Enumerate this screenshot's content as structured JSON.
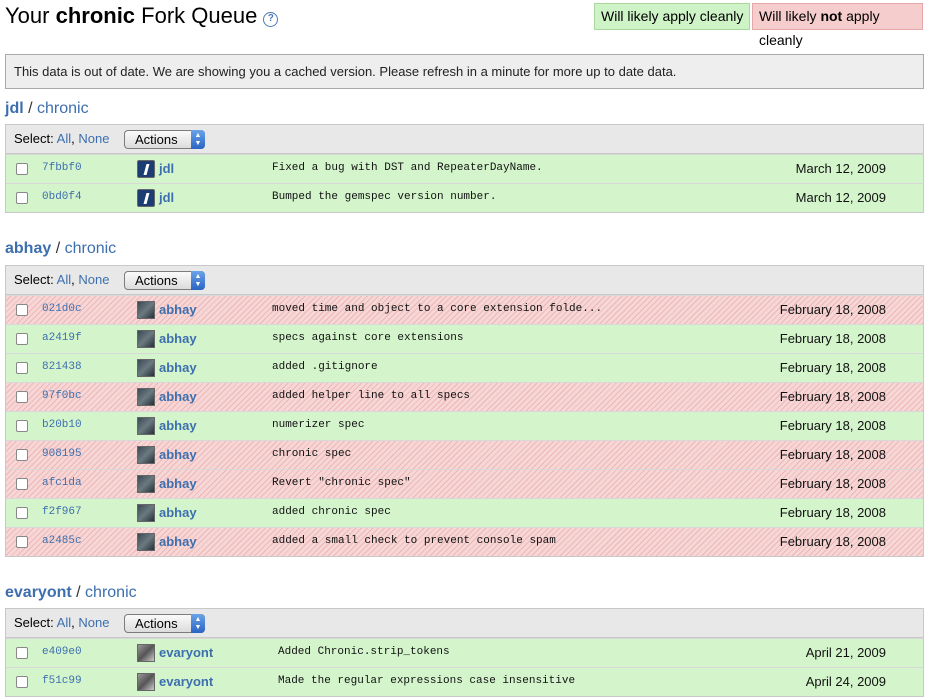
{
  "header": {
    "title_pre": "Your ",
    "title_bold": "chronic",
    "title_post": " Fork Queue",
    "help_icon": "?",
    "legend_clean": "Will likely apply cleanly",
    "legend_dirty_pre": "Will likely ",
    "legend_dirty_bold": "not",
    "legend_dirty_post": " apply cleanly"
  },
  "notice": "This data is out of date. We are showing you a cached version. Please refresh in a minute for more up to date data.",
  "toolbar": {
    "select_label": "Select:",
    "all": "All",
    "none": "None",
    "actions": "Actions"
  },
  "groups": [
    {
      "owner": "jdl",
      "sep": " / ",
      "repo": "chronic",
      "commits": [
        {
          "sha": "7fbbf0",
          "author": "jdl",
          "message": "Fixed a bug with DST and RepeaterDayName.",
          "date": "March 12, 2009",
          "status": "clean"
        },
        {
          "sha": "0bd0f4",
          "author": "jdl",
          "message": "Bumped the gemspec version number.",
          "date": "March 12, 2009",
          "status": "clean"
        }
      ]
    },
    {
      "owner": "abhay",
      "sep": " / ",
      "repo": "chronic",
      "commits": [
        {
          "sha": "021d0c",
          "author": "abhay",
          "message": "moved time and object to a core extension folde...",
          "date": "February 18, 2008",
          "status": "dirty"
        },
        {
          "sha": "a2419f",
          "author": "abhay",
          "message": "specs against core extensions",
          "date": "February 18, 2008",
          "status": "clean"
        },
        {
          "sha": "821438",
          "author": "abhay",
          "message": "added .gitignore",
          "date": "February 18, 2008",
          "status": "clean"
        },
        {
          "sha": "97f0bc",
          "author": "abhay",
          "message": "added helper line to all specs",
          "date": "February 18, 2008",
          "status": "dirty"
        },
        {
          "sha": "b20b10",
          "author": "abhay",
          "message": "numerizer spec",
          "date": "February 18, 2008",
          "status": "clean"
        },
        {
          "sha": "908195",
          "author": "abhay",
          "message": "chronic spec",
          "date": "February 18, 2008",
          "status": "dirty"
        },
        {
          "sha": "afc1da",
          "author": "abhay",
          "message": "Revert \"chronic spec\"",
          "date": "February 18, 2008",
          "status": "dirty"
        },
        {
          "sha": "f2f967",
          "author": "abhay",
          "message": "added chronic spec",
          "date": "February 18, 2008",
          "status": "clean"
        },
        {
          "sha": "a2485c",
          "author": "abhay",
          "message": "added a small check to prevent console spam",
          "date": "February 18, 2008",
          "status": "dirty"
        }
      ]
    },
    {
      "owner": "evaryont",
      "sep": " / ",
      "repo": "chronic",
      "commits": [
        {
          "sha": "e409e0",
          "author": "evaryont",
          "message": "Added Chronic.strip_tokens",
          "date": "April 21, 2009",
          "status": "clean"
        },
        {
          "sha": "f51c99",
          "author": "evaryont",
          "message": "Made the regular expressions case insensitive",
          "date": "April 24, 2009",
          "status": "clean"
        }
      ]
    }
  ],
  "colors": {
    "clean": "#d4f5cc",
    "dirty": "#f7d6d6",
    "link": "#3d6fae"
  }
}
